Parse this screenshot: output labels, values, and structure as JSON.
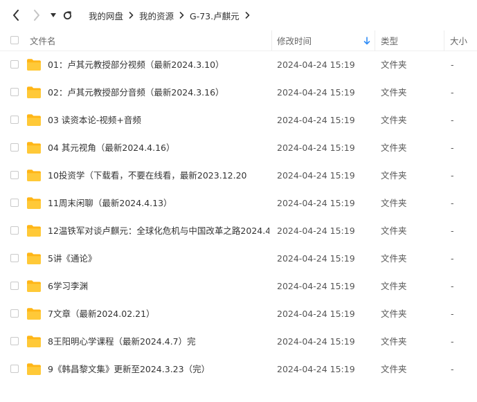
{
  "nav": {
    "back_icon": "chevron-left-icon",
    "forward_icon": "chevron-right-icon",
    "dropdown_icon": "caret-down-icon",
    "refresh_icon": "refresh-icon"
  },
  "breadcrumb": [
    "我的网盘",
    "我的资源",
    "G-73.卢麒元"
  ],
  "columns": {
    "name": "文件名",
    "modified": "修改时间",
    "type": "类型",
    "size": "大小"
  },
  "sort": {
    "column": "modified",
    "direction": "desc",
    "icon": "arrow-down-icon"
  },
  "colors": {
    "folder": "#FFC32E",
    "sort_arrow": "#2F8CF7"
  },
  "files": [
    {
      "name": "01：卢其元教授部分视频（最新2024.3.10）",
      "modified": "2024-04-24 15:19",
      "type": "文件夹",
      "size": "-"
    },
    {
      "name": "02：卢其元教授部分音频（最新2024.3.16）",
      "modified": "2024-04-24 15:19",
      "type": "文件夹",
      "size": "-"
    },
    {
      "name": "03 读资本论-视频+音频",
      "modified": "2024-04-24 15:19",
      "type": "文件夹",
      "size": "-"
    },
    {
      "name": "04 其元视角（最新2024.4.16）",
      "modified": "2024-04-24 15:19",
      "type": "文件夹",
      "size": "-"
    },
    {
      "name": "10投资学（下载看，不要在线看，最新2023.12.20",
      "modified": "2024-04-24 15:19",
      "type": "文件夹",
      "size": "-"
    },
    {
      "name": "11周末闲聊（最新2024.4.13）",
      "modified": "2024-04-24 15:19",
      "type": "文件夹",
      "size": "-"
    },
    {
      "name": "12温铁军对谈卢麒元：全球化危机与中国改革之路2024.4...",
      "modified": "2024-04-24 15:19",
      "type": "文件夹",
      "size": "-"
    },
    {
      "name": "5讲《通论》",
      "modified": "2024-04-24 15:19",
      "type": "文件夹",
      "size": "-"
    },
    {
      "name": "6学习李渊",
      "modified": "2024-04-24 15:19",
      "type": "文件夹",
      "size": "-"
    },
    {
      "name": "7文章（最新2024.02.21）",
      "modified": "2024-04-24 15:19",
      "type": "文件夹",
      "size": "-"
    },
    {
      "name": "8王阳明心学课程（最新2024.4.7）完",
      "modified": "2024-04-24 15:19",
      "type": "文件夹",
      "size": "-"
    },
    {
      "name": "9《韩昌黎文集》更新至2024.3.23（完）",
      "modified": "2024-04-24 15:19",
      "type": "文件夹",
      "size": "-"
    }
  ]
}
